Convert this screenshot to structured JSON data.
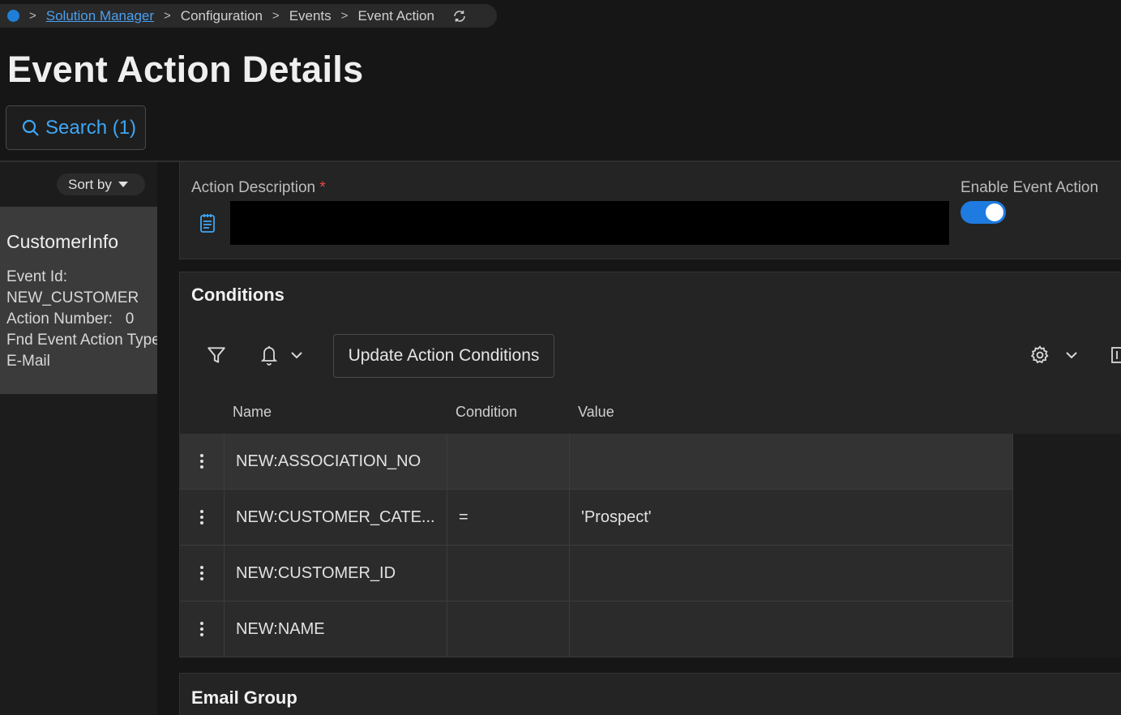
{
  "breadcrumb": {
    "items": [
      "Solution Manager",
      "Configuration",
      "Events",
      "Event Action"
    ]
  },
  "page": {
    "title": "Event Action Details"
  },
  "search": {
    "label": "Search (1)"
  },
  "sidebar": {
    "sort_label": "Sort by",
    "card": {
      "title": "CustomerInfo",
      "lines": [
        "Event Id:",
        "NEW_CUSTOMER",
        "Action Number:   0",
        "Fnd Event Action Type",
        "E-Mail"
      ]
    }
  },
  "details": {
    "action_description_label": "Action Description",
    "required_mark": "*",
    "enable_label": "Enable Event Action",
    "enable_value": true
  },
  "conditions": {
    "title": "Conditions",
    "update_button": "Update Action Conditions",
    "columns": [
      "Name",
      "Condition",
      "Value"
    ],
    "rows": [
      {
        "name": "NEW:ASSOCIATION_NO",
        "condition": "",
        "value": ""
      },
      {
        "name": "NEW:CUSTOMER_CATE...",
        "condition": "=",
        "value": "'Prospect'"
      },
      {
        "name": "NEW:CUSTOMER_ID",
        "condition": "",
        "value": ""
      },
      {
        "name": "NEW:NAME",
        "condition": "",
        "value": ""
      }
    ]
  },
  "email_group": {
    "title": "Email Group"
  },
  "colors": {
    "accent": "#1e7be0",
    "link": "#4a9ff0",
    "search_text": "#3ea6f5",
    "required": "#e64a3b"
  },
  "icons": [
    "home-dot-icon",
    "refresh-icon",
    "search-icon",
    "caret-down-icon",
    "notepad-icon",
    "filter-icon",
    "bell-icon",
    "chevron-down-icon",
    "gear-icon",
    "more-vertical-icon"
  ]
}
